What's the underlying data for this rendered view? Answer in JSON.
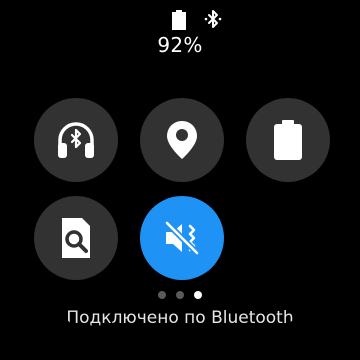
{
  "status_bar": {
    "battery_icon": "battery-icon",
    "bluetooth_icon": "bluetooth-icon",
    "battery_percent": "92%"
  },
  "quick_panel": {
    "tiles": [
      {
        "icon": "bluetooth-headset-icon",
        "active": false
      },
      {
        "icon": "location-pin-icon",
        "active": false
      },
      {
        "icon": "battery-icon",
        "active": false
      },
      {
        "icon": "find-phone-icon",
        "active": false
      },
      {
        "icon": "vibrate-mode-icon",
        "active": true
      }
    ],
    "pages": 3,
    "current_page": 3
  },
  "connection_status": "Подключено по Bluetooth",
  "colors": {
    "background": "#000000",
    "tile": "#323232",
    "active_tile": "#1e93f5",
    "text": "#ffffff"
  }
}
